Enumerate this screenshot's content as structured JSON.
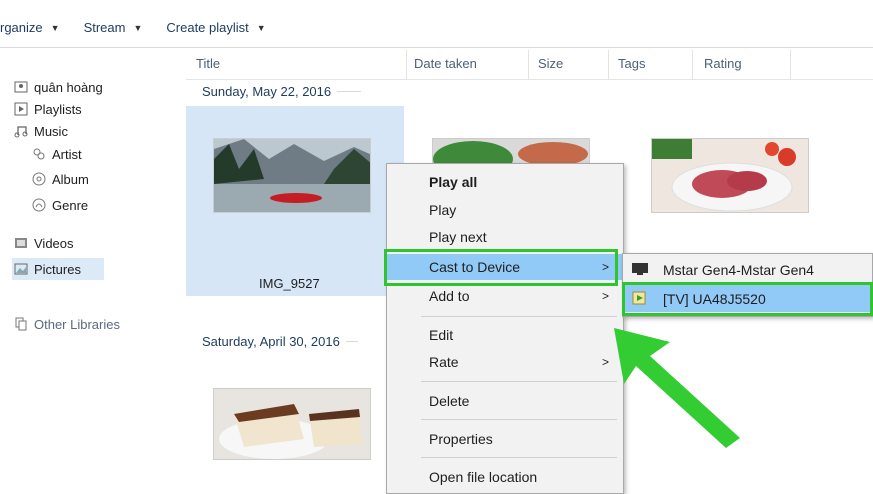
{
  "toolbar": {
    "organize": "rganize",
    "stream": "Stream",
    "create_playlist": "Create playlist"
  },
  "nav": {
    "items": [
      {
        "label": "quân hoàng",
        "icon": "user-library-icon"
      },
      {
        "label": "Playlists",
        "icon": "playlist-icon"
      },
      {
        "label": "Music",
        "icon": "music-note-icon"
      },
      {
        "label": "Artist",
        "icon": "artist-icon"
      },
      {
        "label": "Album",
        "icon": "album-icon"
      },
      {
        "label": "Genre",
        "icon": "genre-icon"
      },
      {
        "label": "Videos",
        "icon": "video-icon"
      },
      {
        "label": "Pictures",
        "icon": "picture-icon"
      },
      {
        "label": "Other Libraries",
        "icon": "other-libraries-icon"
      }
    ]
  },
  "columns": [
    "Title",
    "Date taken",
    "Size",
    "Tags",
    "Rating"
  ],
  "groups": {
    "first": "Sunday, May 22, 2016",
    "second": "Saturday, April 30, 2016"
  },
  "tiles": {
    "selected_name": "IMG_9527"
  },
  "context_menu": {
    "items": [
      "Play all",
      "Play",
      "Play next",
      "Cast to Device",
      "Add to",
      "Edit",
      "Rate",
      "Delete",
      "Properties",
      "Open file location"
    ]
  },
  "cast_submenu": {
    "items": [
      "Mstar Gen4-Mstar Gen4",
      "[TV] UA48J5520"
    ]
  },
  "colors": {
    "highlight": "#91c9f7",
    "selection": "#d6e6f7",
    "annotation": "#2ec52e"
  }
}
